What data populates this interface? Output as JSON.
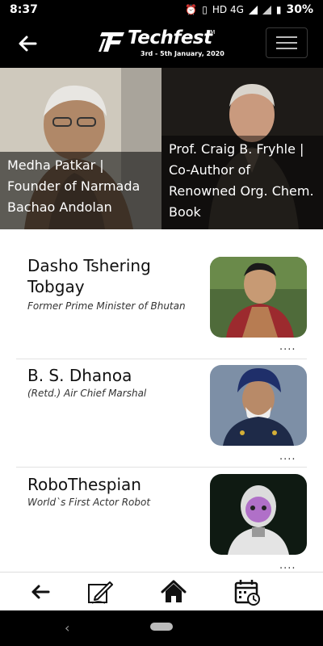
{
  "status_bar": {
    "time": "8:37",
    "network": "HD 4G",
    "battery": "30%"
  },
  "app_bar": {
    "logo_text": "Techfest",
    "logo_dates": "3rd - 5th January, 2020",
    "logo_tm": "TM"
  },
  "featured": [
    {
      "caption_lines": [
        "Medha Patkar |",
        "Founder of Narmada",
        "Bachao Andolan"
      ]
    },
    {
      "caption_lines": [
        "Prof. Craig B. Fryhle |",
        "Co-Author of",
        "Renowned Org. Chem.",
        "Book"
      ]
    }
  ],
  "speakers": [
    {
      "name": "Dasho Tshering Tobgay",
      "role": "Former Prime Minister of Bhutan",
      "more": "...."
    },
    {
      "name": "B. S. Dhanoa",
      "role": "(Retd.) Air Chief Marshal",
      "more": "...."
    },
    {
      "name": "RoboThespian",
      "role": "World`s First Actor Robot",
      "more": "...."
    }
  ],
  "bottom_nav": {
    "items": [
      {
        "icon": "back-arrow-icon"
      },
      {
        "icon": "edit-note-icon"
      },
      {
        "icon": "home-icon"
      },
      {
        "icon": "calendar-icon"
      }
    ]
  },
  "colors": {
    "app_bar_bg": "#000000",
    "list_bg": "#ffffff",
    "caption_overlay": "rgba(0,0,0,0.55)"
  }
}
